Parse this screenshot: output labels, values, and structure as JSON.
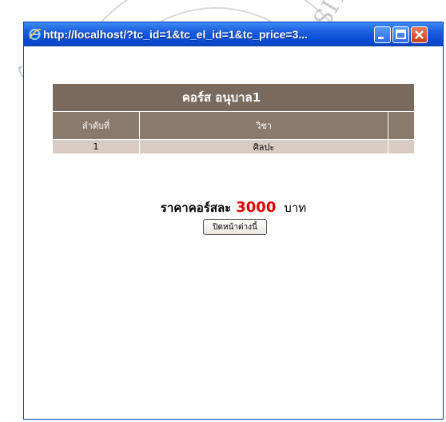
{
  "window": {
    "title": "http://localhost/?tc_id=1&tc_el_id=1&tc_price=3..."
  },
  "course": {
    "title": "คอร์ส อนุบาล1",
    "headers": {
      "order": "ลำดับที่",
      "subject": "วิชา",
      "extra": ""
    },
    "rows": [
      {
        "order": "1",
        "subject": "ศิลปะ",
        "extra": ""
      }
    ]
  },
  "price": {
    "label": "ราคาคอร์สละ",
    "value": "3000",
    "unit": "บาท"
  },
  "close_button": {
    "label": "ปิดหน้าต่างนี้"
  },
  "watermark": {
    "text_left": "SONGKHLA RAJABHAT",
    "text_right": "UNIVERSITY"
  },
  "colors": {
    "titlebar": "#0a4fd6",
    "table_header": "#7a6a5d",
    "table_row": "#d8ccc2",
    "price_number": "#e00000"
  }
}
